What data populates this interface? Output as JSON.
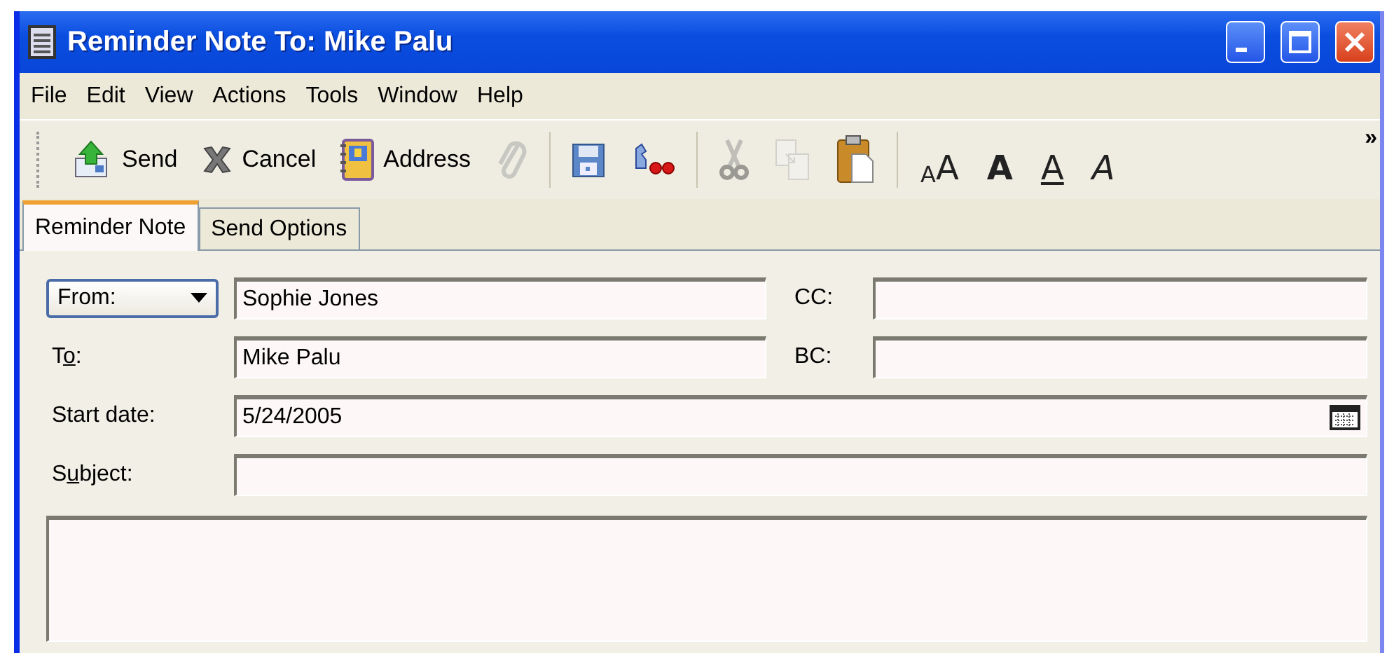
{
  "window": {
    "title": "Reminder Note To: Mike Palu"
  },
  "menu": [
    "File",
    "Edit",
    "View",
    "Actions",
    "Tools",
    "Window",
    "Help"
  ],
  "toolbar": [
    {
      "kind": "send",
      "label": "Send",
      "disabled": false
    },
    {
      "kind": "cancel",
      "label": "Cancel",
      "disabled": false
    },
    {
      "kind": "address",
      "label": "Address",
      "disabled": false
    },
    {
      "kind": "attach",
      "disabled": true
    },
    {
      "kind": "separator"
    },
    {
      "kind": "save",
      "disabled": false
    },
    {
      "kind": "spell",
      "disabled": false
    },
    {
      "kind": "separator"
    },
    {
      "kind": "cut",
      "disabled": true
    },
    {
      "kind": "copy",
      "disabled": true
    },
    {
      "kind": "paste",
      "disabled": false
    },
    {
      "kind": "separator"
    },
    {
      "kind": "font",
      "glyphs": [
        "A",
        "A"
      ],
      "disabled": false
    },
    {
      "kind": "bold",
      "glyphs": [
        "A"
      ],
      "disabled": false
    },
    {
      "kind": "underline",
      "glyphs": [
        "A"
      ],
      "disabled": false
    },
    {
      "kind": "italic",
      "glyphs": [
        "A"
      ],
      "disabled": false
    }
  ],
  "toolbar_overflow": "»",
  "tabs": [
    {
      "label": "Reminder Note",
      "selected": true
    },
    {
      "label": "Send Options",
      "selected": false
    }
  ],
  "form": {
    "from": {
      "label": "From:",
      "value": "Sophie Jones"
    },
    "cc": {
      "label": "CC:"
    },
    "to": {
      "label": {
        "before": "T",
        "key": "o",
        "after": ":"
      },
      "value": "Mike Palu"
    },
    "bc": {
      "label": "BC:"
    },
    "start_date": {
      "label": "Start date:",
      "value": "5/24/2005"
    },
    "subject": {
      "label": {
        "before": "S",
        "key": "u",
        "after": "bject:"
      }
    }
  }
}
